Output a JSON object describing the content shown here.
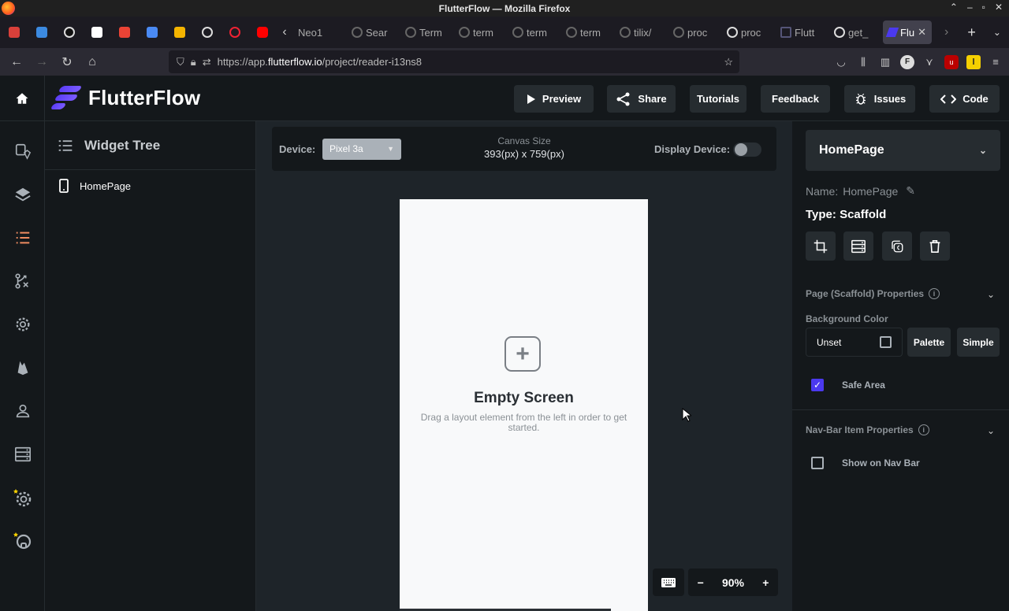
{
  "window": {
    "title": "FlutterFlow — Mozilla Firefox"
  },
  "tabs": [
    {
      "label": "Neo1"
    },
    {
      "label": "Sear"
    },
    {
      "label": "Term"
    },
    {
      "label": "term"
    },
    {
      "label": "term"
    },
    {
      "label": "term"
    },
    {
      "label": "tilix/"
    },
    {
      "label": "proc"
    },
    {
      "label": "proc"
    },
    {
      "label": "Flutt"
    },
    {
      "label": "get_"
    },
    {
      "label": "Flu"
    }
  ],
  "url": {
    "prefix": "https://app.",
    "host": "flutterflow.io",
    "path": "/project/reader-i13ns8"
  },
  "app": {
    "brand": "FlutterFlow",
    "header_buttons": {
      "preview": "Preview",
      "share": "Share",
      "tutorials": "Tutorials",
      "feedback": "Feedback",
      "issues": "Issues",
      "code": "Code"
    }
  },
  "widget_tree": {
    "title": "Widget Tree",
    "items": [
      "HomePage"
    ]
  },
  "canvas": {
    "device_label": "Device:",
    "device_value": "Pixel 3a",
    "canvas_size_label": "Canvas Size",
    "canvas_size_value": "393(px) x 759(px)",
    "display_device_label": "Display Device:",
    "empty_title": "Empty Screen",
    "empty_subtitle": "Drag a layout element from the left in order to get started.",
    "zoom": "90%"
  },
  "properties": {
    "page_name": "HomePage",
    "name_label": "Name:",
    "name_value": "HomePage",
    "type_label": "Type:",
    "type_value": "Scaffold",
    "section_page": "Page (Scaffold) Properties",
    "bg_label": "Background Color",
    "bg_value": "Unset",
    "palette": "Palette",
    "simple": "Simple",
    "safe_area": "Safe Area",
    "section_nav": "Nav-Bar Item Properties",
    "show_nav": "Show on Nav Bar"
  },
  "colors": {
    "accent": "#4b39ef",
    "sidebar_active": "#ee8b60"
  }
}
